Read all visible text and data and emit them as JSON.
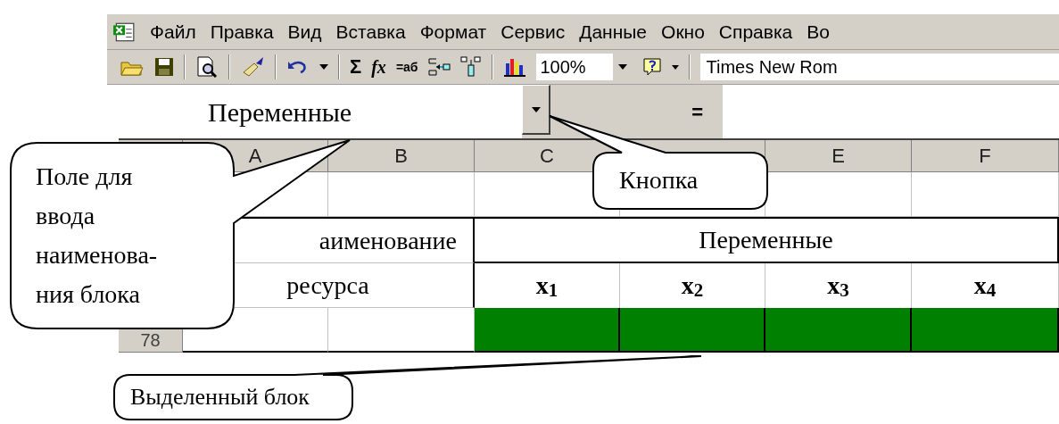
{
  "menu": [
    "Файл",
    "Правка",
    "Вид",
    "Вставка",
    "Формат",
    "Сервис",
    "Данные",
    "Окно",
    "Справка",
    "Во"
  ],
  "toolbar": {
    "sum_label": "Σ",
    "function_label": "fx",
    "text_label": "=аб",
    "zoom": "100%",
    "font": "Times New Rom"
  },
  "formula_bar": {
    "name_box": "Переменные",
    "equals": "="
  },
  "columns": [
    {
      "letter": "A"
    },
    {
      "letter": "B"
    },
    {
      "letter": "C"
    },
    {},
    {
      "letter": "E"
    },
    {
      "letter": "F"
    }
  ],
  "rows": [
    {
      "cells": []
    },
    {
      "cells": [
        {
          "text": "аименование",
          "kind": "left"
        },
        {
          "text": "Переменные",
          "kind": "right"
        }
      ]
    },
    {
      "cells": [
        {
          "text": "ресурса",
          "kind": "left"
        },
        {
          "text": "x$_{1}$"
        },
        {
          "text": "x$_{2}$"
        },
        {
          "text": "x$_{3}$"
        },
        {
          "text": "x$_{4}$"
        }
      ]
    },
    {
      "header": "78",
      "selected": [
        false,
        false,
        true,
        true,
        true,
        true
      ]
    }
  ],
  "callouts": [
    {
      "text": "Поле для\nввода\nнаименова-\nния блока"
    },
    {
      "text": "Кнопка"
    },
    {
      "text": "Выделенный блок"
    }
  ]
}
